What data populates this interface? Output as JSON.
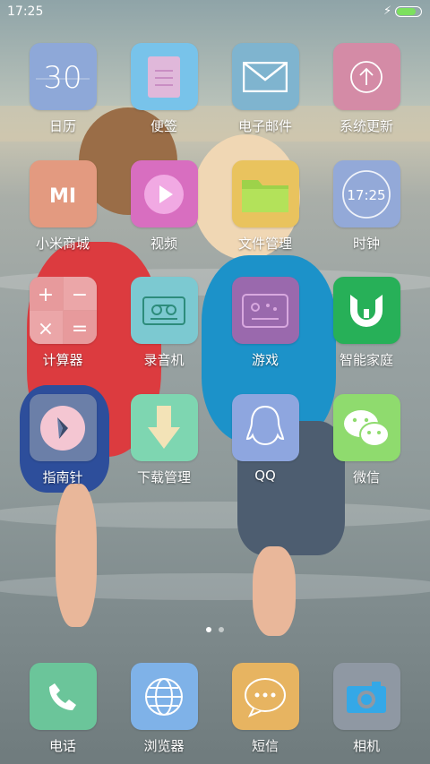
{
  "status_bar": {
    "time": "17:25",
    "battery_level": 0.9,
    "charging": true
  },
  "home": {
    "rows": [
      [
        {
          "label": "日历",
          "icon": "calendar-icon",
          "icon_text": "30",
          "color": "#8ea8d8"
        },
        {
          "label": "便签",
          "icon": "notes-icon",
          "color": "#78c3ea"
        },
        {
          "label": "电子邮件",
          "icon": "mail-icon",
          "color": "#7fb4cf"
        },
        {
          "label": "系统更新",
          "icon": "update-icon",
          "color": "#d48ba6"
        }
      ],
      [
        {
          "label": "小米商城",
          "icon": "mi-store-icon",
          "icon_text": "MI",
          "color": "#e39a80"
        },
        {
          "label": "视频",
          "icon": "video-icon",
          "color": "#d86ec0"
        },
        {
          "label": "文件管理",
          "icon": "folder-icon",
          "color": "#e9c35e"
        },
        {
          "label": "时钟",
          "icon": "clock-icon",
          "icon_text": "17:25",
          "color": "#93a9d8"
        }
      ],
      [
        {
          "label": "计算器",
          "icon": "calculator-icon",
          "color": "#e39a9b"
        },
        {
          "label": "录音机",
          "icon": "recorder-icon",
          "color": "#7cc9d1"
        },
        {
          "label": "游戏",
          "icon": "game-icon",
          "color": "#9a69ad"
        },
        {
          "label": "智能家庭",
          "icon": "smart-home-icon",
          "color": "#27b058"
        }
      ],
      [
        {
          "label": "指南针",
          "icon": "compass-icon",
          "color": "#6b7fa8"
        },
        {
          "label": "下载管理",
          "icon": "download-icon",
          "color": "#7ed6b1"
        },
        {
          "label": "QQ",
          "icon": "qq-icon",
          "color": "#8ea6df"
        },
        {
          "label": "微信",
          "icon": "wechat-icon",
          "color": "#8fdb6e"
        }
      ]
    ],
    "page_indicator": {
      "pages": 2,
      "current": 1
    }
  },
  "dock": [
    {
      "label": "电话",
      "icon": "phone-icon",
      "color": "#6bc59a"
    },
    {
      "label": "浏览器",
      "icon": "browser-icon",
      "color": "#7fb2e8"
    },
    {
      "label": "短信",
      "icon": "sms-icon",
      "color": "#e7b461"
    },
    {
      "label": "相机",
      "icon": "camera-icon",
      "color": "#8f98a3"
    }
  ]
}
